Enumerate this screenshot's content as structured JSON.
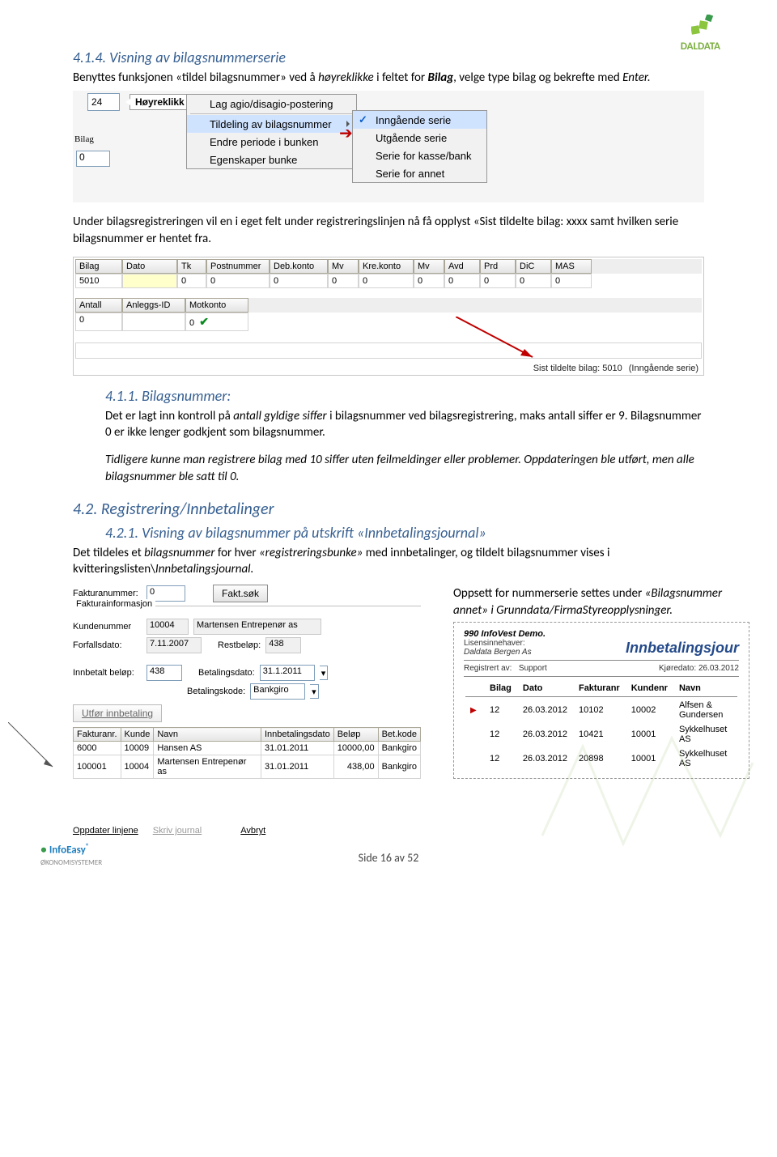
{
  "logo": {
    "brand": "DALDATA"
  },
  "sec414": {
    "heading": "4.1.4.    Visning av bilagsnummerserie",
    "p1a": "Benyttes funksjonen «tildel bilagsnummer» ved å ",
    "p1b": "høyreklikke",
    "p1c": " i feltet for ",
    "p1d": "Bilag",
    "p1e": ", velge type bilag og bekrefte med ",
    "p1f": "Enter."
  },
  "menu": {
    "topnum": "24",
    "tooltip": "Høyreklikk",
    "items": {
      "agio": "Lag agio/disagio-postering",
      "sep": "",
      "tildel": "Tildeling av bilagsnummer",
      "periode": "Endre periode i bunken",
      "egen": "Egenskaper bunke"
    },
    "sub": {
      "inn": "Inngående serie",
      "ut": "Utgående serie",
      "kasse": "Serie for kasse/bank",
      "annet": "Serie for annet"
    },
    "row2": {
      "label": "Bilag",
      "val": "0"
    }
  },
  "para_under": "Under bilagsregistreringen vil en i eget felt under registreringslinjen nå få opplyst «Sist tildelte bilag: xxxx samt hvilken serie bilagsnummer er hentet fra.",
  "table1": {
    "headers": [
      "Bilag",
      "Dato",
      "Tk",
      "Postnummer",
      "Deb.konto",
      "Mv",
      "Kre.konto",
      "Mv",
      "Avd",
      "Prd",
      "DiC",
      "MAS"
    ],
    "row": [
      "5010",
      "",
      "0",
      "0",
      "0",
      "0",
      "0",
      "0",
      "0",
      "0",
      "0",
      "0"
    ],
    "headers2": [
      "Antall",
      "Anleggs-ID",
      "Motkonto"
    ],
    "row2": [
      "0",
      "",
      "0"
    ],
    "footer_label": "Sist tildelte bilag: 5010",
    "footer_serie": "(Inngående serie)"
  },
  "sec411": {
    "heading": "4.1.1.    Bilagsnummer:",
    "p1a": "Det er lagt inn kontroll på ",
    "p1b": "antall gyldige siffer",
    "p1c": " i bilagsnummer ved bilagsregistrering, maks antall siffer er 9. Bilagsnummer 0 er ikke lenger godkjent som bilagsnummer.",
    "p2": "Tidligere kunne man registrere bilag med 10 siffer uten feilmeldinger eller problemer. Oppdateringen ble utført, men alle bilagsnummer ble satt til 0."
  },
  "sec42": {
    "heading": "4.2. Registrering/Innbetalinger"
  },
  "sec421": {
    "heading": "4.2.1.    Visning av bilagsnummer på utskrift «Innbetalingsjournal»",
    "p1a": "Det tildeles et ",
    "p1b": "bilagsnummer",
    "p1c": " for hver ",
    "p1d": "«registreringsbunke»",
    "p1e": " med innbetalinger, og tildelt bilagsnummer vises i kvitteringslisten\\",
    "p1f": "Innbetalingsjournal."
  },
  "payright": {
    "a": "Oppsett for nummerserie settes under ",
    "b": "«Bilagsnummer annet» i Grunndata/FirmaStyreopplysninger."
  },
  "payform": {
    "faktnr_label": "Fakturanummer:",
    "faktnr": "0",
    "faktsok": "Fakt.søk",
    "faktinfo": "Fakturainformasjon",
    "kundenr_label": "Kundenummer",
    "kundenr": "10004",
    "kundenavn": "Martensen Entrepenør as",
    "forfall_label": "Forfallsdato:",
    "forfall": "7.11.2007",
    "restbelop_label": "Restbeløp:",
    "restbelop": "438",
    "innbelop_label": "Innbetalt beløp:",
    "innbelop": "438",
    "betdato_label": "Betalingsdato:",
    "betdato": "31.1.2011",
    "betkode_label": "Betalingskode:",
    "betkode": "Bankgiro",
    "utfør": "Utfør innbetaling"
  },
  "paytable": {
    "headers": [
      "Fakturanr.",
      "Kunde",
      "Navn",
      "Innbetalingsdato",
      "Beløp",
      "Bet.kode"
    ],
    "rows": [
      [
        "6000",
        "10009",
        "Hansen AS",
        "31.01.2011",
        "10000,00",
        "Bankgiro"
      ],
      [
        "100001",
        "10004",
        "Martensen Entrepenør as",
        "31.01.2011",
        "438,00",
        "Bankgiro"
      ]
    ]
  },
  "journal": {
    "firm": "990 InfoVest Demo.",
    "lisens_lbl": "Lisensinnehaver:",
    "lisens": "Daldata Bergen As",
    "title": "Innbetalingsjour",
    "reg_lbl": "Registrert av:",
    "reg": "Support",
    "kjore_lbl": "Kjøredato:",
    "kjore": "26.03.2012",
    "headers": [
      "Bilag",
      "Dato",
      "Fakturanr",
      "Kundenr",
      "Navn"
    ],
    "rows": [
      [
        "12",
        "26.03.2012",
        "10102",
        "10002",
        "Alfsen & Gundersen"
      ],
      [
        "12",
        "26.03.2012",
        "10421",
        "10001",
        "Sykkelhuset AS"
      ],
      [
        "12",
        "26.03.2012",
        "20898",
        "10001",
        "Sykkelhuset AS"
      ]
    ]
  },
  "footer_btns": {
    "oppdater": "Oppdater linjene",
    "skriv": "Skriv journal",
    "avbryt": "Avbryt"
  },
  "pagenum": "Side 16 av 52",
  "footer_logo": {
    "name": "InfoEasy",
    "sub": "ØKONOMISYSTEMER"
  }
}
